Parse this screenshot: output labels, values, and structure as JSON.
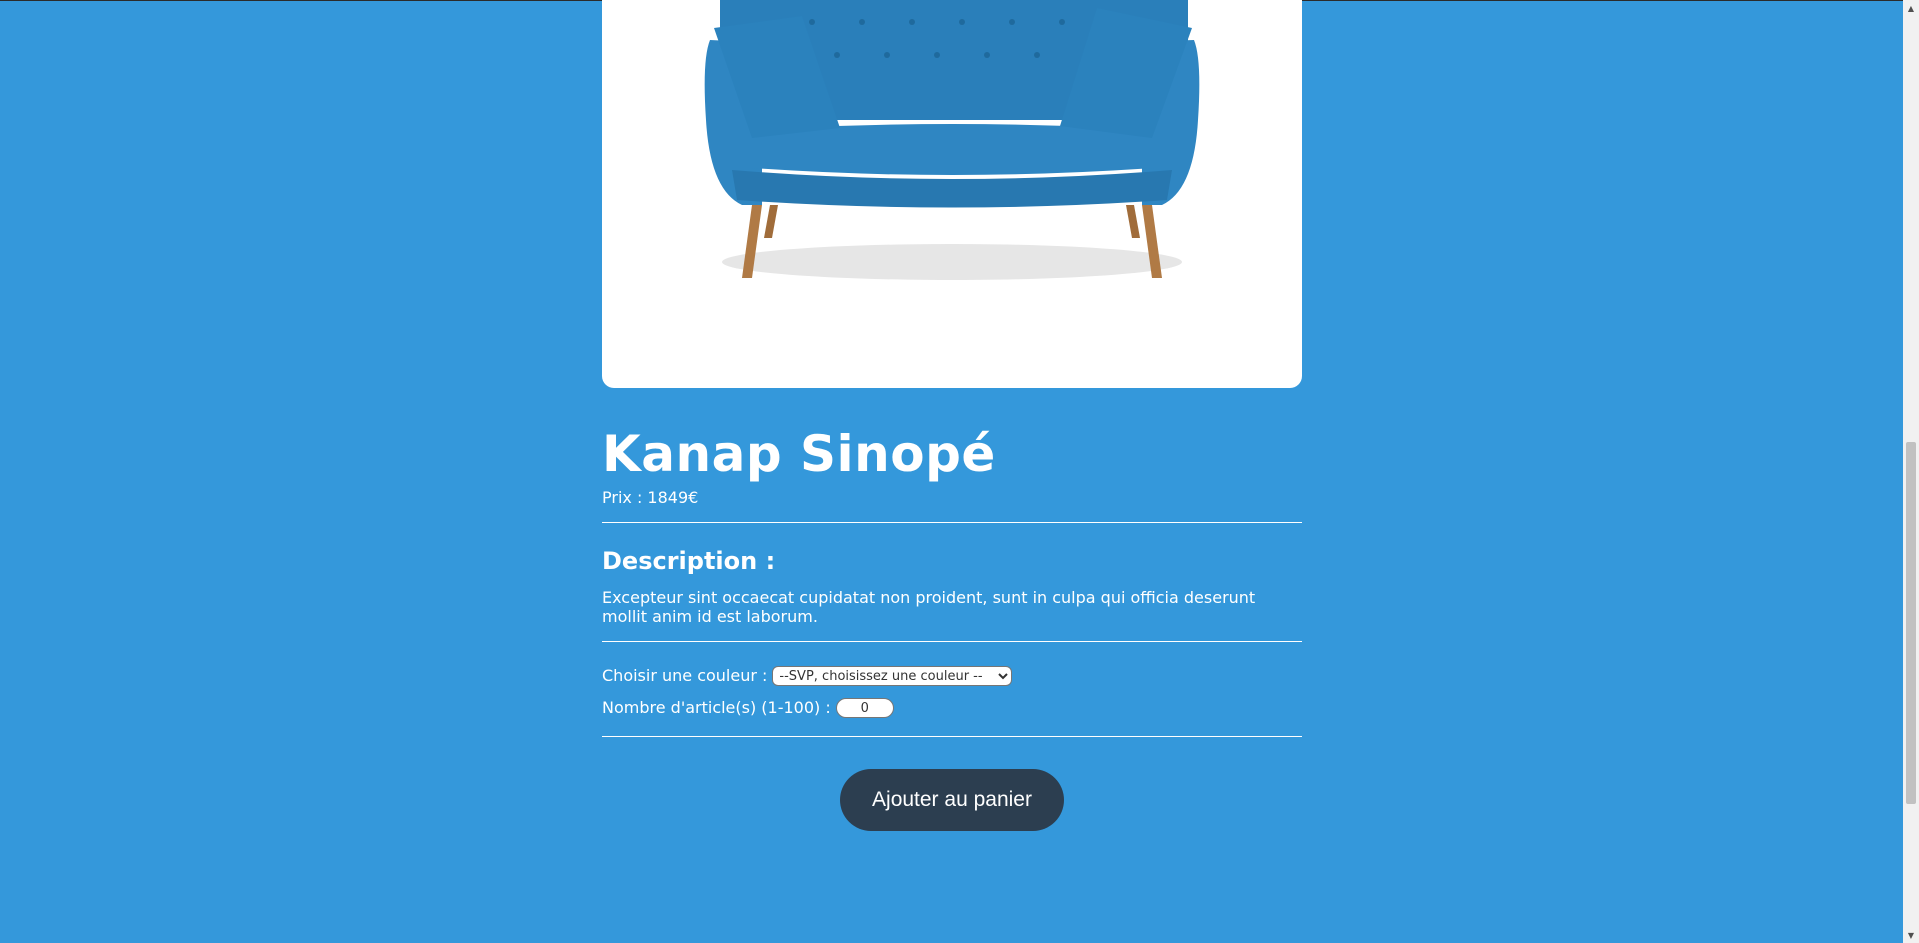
{
  "product": {
    "name": "Kanap Sinopé",
    "price_label": "Prix : ",
    "price_value": "1849",
    "currency": "€"
  },
  "description": {
    "title": "Description :",
    "text": "Excepteur sint occaecat cupidatat non proident, sunt in culpa qui officia deserunt mollit anim id est laborum."
  },
  "options": {
    "color_label": "Choisir une couleur :",
    "color_selected": "--SVP, choisissez une couleur --",
    "quantity_label": "Nombre d'article(s) (1-100) :",
    "quantity_value": "0"
  },
  "actions": {
    "add_to_cart": "Ajouter au panier"
  },
  "theme": {
    "background": "#3498db",
    "button": "#2c3e50",
    "sofa": "#2f86c2"
  },
  "icons": {
    "scroll_up": "arrow-up-icon",
    "scroll_down": "arrow-down-icon"
  }
}
